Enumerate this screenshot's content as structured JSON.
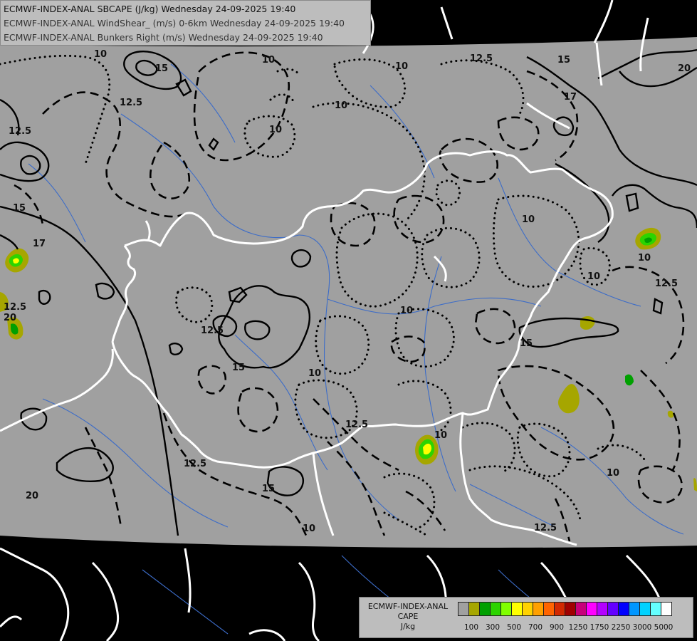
{
  "titles": [
    "ECMWF-INDEX-ANAL SBCAPE (J/kg) Wednesday 24-09-2025 19:40",
    "ECMWF-INDEX-ANAL WindShear_ (m/s) 0-6km Wednesday 24-09-2025 19:40",
    "ECMWF-INDEX-ANAL Bunkers Right (m/s) Wednesday 24-09-2025 19:40"
  ],
  "legend": {
    "title_line1": "ECMWF-INDEX-ANAL",
    "title_line2": "CAPE",
    "unit": "J/kg",
    "colors": [
      "#a0a0a0",
      "#a6a600",
      "#00a000",
      "#2cd400",
      "#80ff00",
      "#ffff00",
      "#ffd200",
      "#ffa000",
      "#ff6400",
      "#d22800",
      "#a00000",
      "#c8007a",
      "#ff00ff",
      "#b400ff",
      "#6400ff",
      "#0000ff",
      "#0096ff",
      "#00d2ff",
      "#64ffff",
      "#ffffff"
    ],
    "tick_labels": [
      "100",
      "300",
      "500",
      "700",
      "900",
      "1250",
      "1750",
      "2250",
      "3000",
      "5000"
    ]
  },
  "contour_labels": [
    "10",
    "12.5",
    "15",
    "17",
    "20"
  ],
  "colors": {
    "background": "#000000",
    "data_area": "#a0a0a0",
    "country_border": "#ffffff",
    "river": "#3c6cc8",
    "contour": "#000000"
  }
}
